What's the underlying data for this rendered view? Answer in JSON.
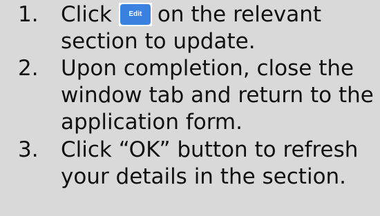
{
  "steps": [
    {
      "number": "1.",
      "line1_before": "Click",
      "button_label": "Edit",
      "line1_after": "on the relevant",
      "line2": "section to update."
    },
    {
      "number": "2.",
      "lines": [
        "Upon completion, close the",
        "window tab and return to the",
        "application form."
      ]
    },
    {
      "number": "3.",
      "lines": [
        "Click “OK” button to refresh",
        "your details in the section."
      ]
    }
  ],
  "colors": {
    "background": "#d9d9d9",
    "edit_button": "#3b82e0",
    "text": "#111111"
  }
}
